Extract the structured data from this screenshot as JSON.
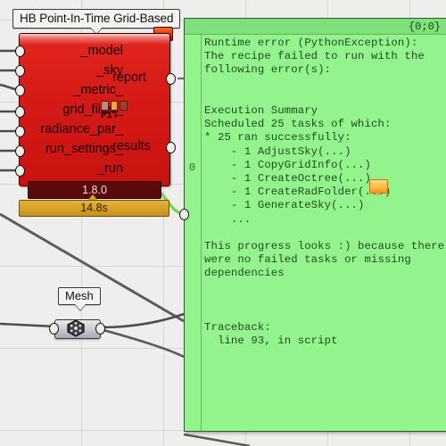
{
  "canvas": {
    "background_color": "#eeeeec",
    "grid_color": "#aaaaaa"
  },
  "component": {
    "title": "HB Point-In-Time Grid-Based",
    "version": "1.8.0",
    "runtime": "14.8s",
    "body_color": "#d61b17",
    "version_strip_color": "#5a0a0a",
    "timer_color": "#d8a126",
    "icon_label": "PIT",
    "error_marker": "error-balloon",
    "inputs": [
      {
        "label": "_model"
      },
      {
        "label": "_sky"
      },
      {
        "label": "_metric_"
      },
      {
        "label": "grid_filter_"
      },
      {
        "label": "radiance_par_"
      },
      {
        "label": "run_settings_"
      },
      {
        "label": "_run"
      }
    ],
    "outputs": [
      {
        "label": "report"
      },
      {
        "label": "results"
      }
    ]
  },
  "mesh_component": {
    "title": "Mesh",
    "icon": "mesh-hexagon-icon"
  },
  "panel": {
    "path_label": "{0;0}",
    "gutter_index": "0",
    "background_color": "#93f48e",
    "header_color": "#7ee07a",
    "warning_marker": "warning-balloon",
    "text": "Runtime error (PythonException):\nThe recipe failed to run with the\nfollowing error(s):\n\n\nExecution Summary\nScheduled 25 tasks of which:\n* 25 ran successfully:\n    - 1 AdjustSky(...)\n    - 1 CopyGridInfo(...)\n    - 1 CreateOctree(...)\n    - 1 CreateRadFolder(...)\n    - 1 GenerateSky(...)\n    ...\n\nThis progress looks :) because there\nwere no failed tasks or missing\ndependencies\n\n\n\nTraceback:\n  line 93, in script"
  }
}
